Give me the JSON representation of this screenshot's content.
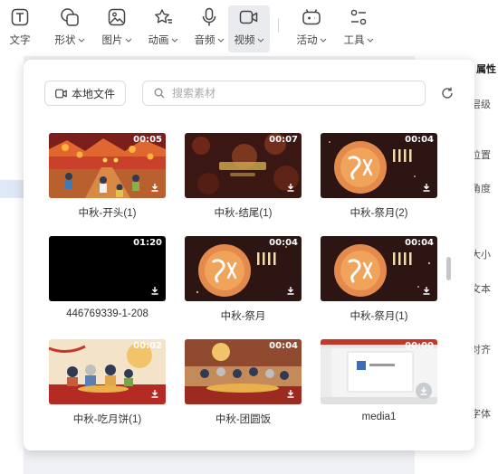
{
  "toolbar": {
    "items": [
      {
        "label": "文字",
        "icon": "text-icon",
        "dropdown": false
      },
      {
        "label": "形状",
        "icon": "shape-icon",
        "dropdown": true
      },
      {
        "label": "图片",
        "icon": "image-icon",
        "dropdown": true
      },
      {
        "label": "动画",
        "icon": "animation-stars-icon",
        "dropdown": true
      },
      {
        "label": "音频",
        "icon": "microphone-icon",
        "dropdown": true
      },
      {
        "label": "视频",
        "icon": "video-camera-icon",
        "dropdown": true,
        "active": true
      },
      {
        "label": "活动",
        "icon": "activity-icon",
        "dropdown": true
      },
      {
        "label": "工具",
        "icon": "tools-icon",
        "dropdown": true
      }
    ]
  },
  "right_panel": {
    "title": "属性",
    "fragments": [
      "层级",
      "位置",
      "角度",
      "大小",
      "文本",
      "对齐",
      "字体"
    ]
  },
  "panel": {
    "local_file_label": "本地文件",
    "search_placeholder": "搜索素材",
    "videos": [
      {
        "title": "中秋-开头(1)",
        "duration": "00:05"
      },
      {
        "title": "中秋-结尾(1)",
        "duration": "00:07"
      },
      {
        "title": "中秋-祭月(2)",
        "duration": "00:04"
      },
      {
        "title": "446769339-1-208",
        "duration": "01:20"
      },
      {
        "title": "中秋-祭月",
        "duration": "00:04"
      },
      {
        "title": "中秋-祭月(1)",
        "duration": "00:04"
      },
      {
        "title": "中秋-吃月饼(1)",
        "duration": "00:02"
      },
      {
        "title": "中秋-团圆饭",
        "duration": "00:04"
      },
      {
        "title": "media1",
        "duration": "00:00"
      }
    ]
  },
  "colors": {
    "accent": "#2f6fde",
    "moon": "#f0a35a",
    "festive_red": "#c0392b"
  }
}
